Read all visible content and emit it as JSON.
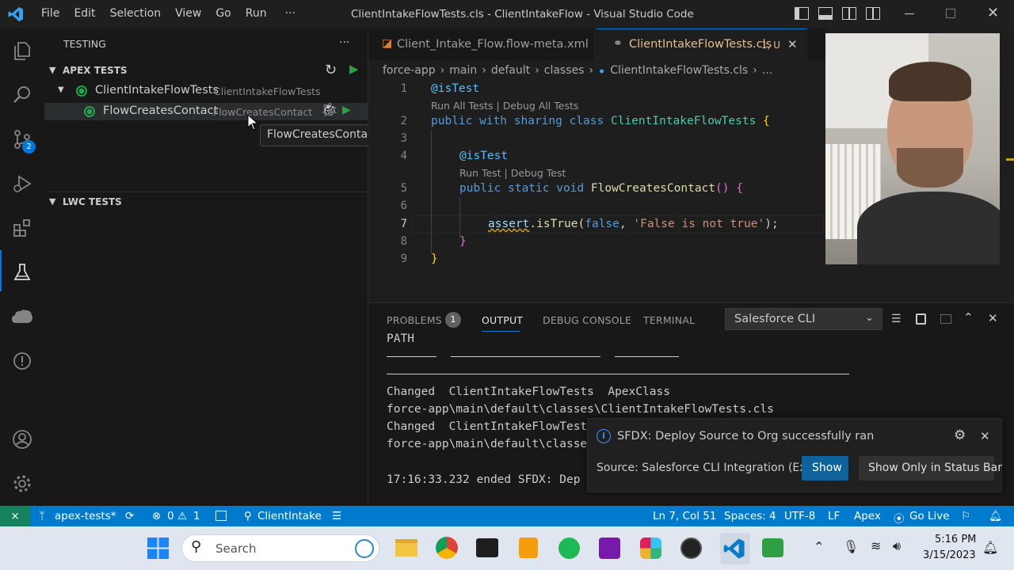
{
  "titlebar": {
    "menu": [
      "File",
      "Edit",
      "Selection",
      "View",
      "Go",
      "Run",
      "···"
    ],
    "title": "ClientIntakeFlowTests.cls - ClientIntakeFlow - Visual Studio Code"
  },
  "activity": {
    "scm_badge": "2"
  },
  "sidebar": {
    "header": "TESTING",
    "more": "···",
    "apex_section": "APEX TESTS",
    "suite_name": "ClientIntakeFlowTests",
    "suite_desc": "ClientIntakeFlowTests",
    "test_name": "FlowCreatesContact",
    "test_desc": "FlowCreatesContact",
    "tooltip": "FlowCreatesContact",
    "lwc_section": "LWC TESTS"
  },
  "editor": {
    "tabs": [
      {
        "label": "Client_Intake_Flow.flow-meta.xml"
      },
      {
        "label": "ClientIntakeFlowTests.cls",
        "suffix": "1, U"
      }
    ],
    "breadcrumb": [
      "force-app",
      "main",
      "default",
      "classes",
      "ClientIntakeFlowTests.cls",
      "..."
    ],
    "line_numbers": [
      "1",
      "2",
      "3",
      "4",
      "5",
      "6",
      "7",
      "8",
      "9"
    ],
    "lens1": "Run All Tests | Debug All Tests",
    "lens2": "Run Test | Debug Test",
    "code": {
      "l1": "@isTest",
      "l2a": "public with sharing class ",
      "l2b": "ClientIntakeFlowTests",
      "l2c": " {",
      "l4": "@isTest",
      "l5a": "public static void ",
      "l5b": "FlowCreatesContact",
      "l5c": "() {",
      "l7a": "assert",
      "l7b": ".isTrue(",
      "l7c": "false",
      "l7d": ", ",
      "l7e": "'False is not true'",
      "l7f": ");",
      "l8": "}",
      "l9": "}"
    }
  },
  "panel": {
    "tabs": [
      "PROBLEMS",
      "OUTPUT",
      "DEBUG CONSOLE",
      "TERMINAL"
    ],
    "problems_count": "1",
    "channel": "Salesforce CLI",
    "output": {
      "path": "PATH",
      "r1": "Changed  ClientIntakeFlowTests  ApexClass",
      "r2": "force-app\\main\\default\\classes\\ClientIntakeFlowTests.cls",
      "r3": "Changed  ClientIntakeFlowTests",
      "r4": "force-app\\main\\default\\classes",
      "r5": "17:16:33.232 ended SFDX: Dep"
    }
  },
  "notification": {
    "message": "SFDX: Deploy Source to Org successfully ran",
    "source": "Source: Salesforce CLI Integration (Exte...",
    "show": "Show",
    "show_status": "Show Only in Status Bar"
  },
  "status": {
    "branch": "apex-tests*",
    "errors": "0",
    "warnings": "1",
    "org": "ClientIntake",
    "position": "Ln 7, Col 51",
    "spaces": "Spaces: 4",
    "encoding": "UTF-8",
    "eol": "LF",
    "language": "Apex",
    "golive": "Go Live"
  },
  "taskbar": {
    "search": "Search",
    "time": "5:16 PM",
    "date": "3/15/2023"
  },
  "colors": {
    "accent": "#007acc",
    "test_pass": "#1fa84a",
    "run_green": "#2ea043"
  }
}
